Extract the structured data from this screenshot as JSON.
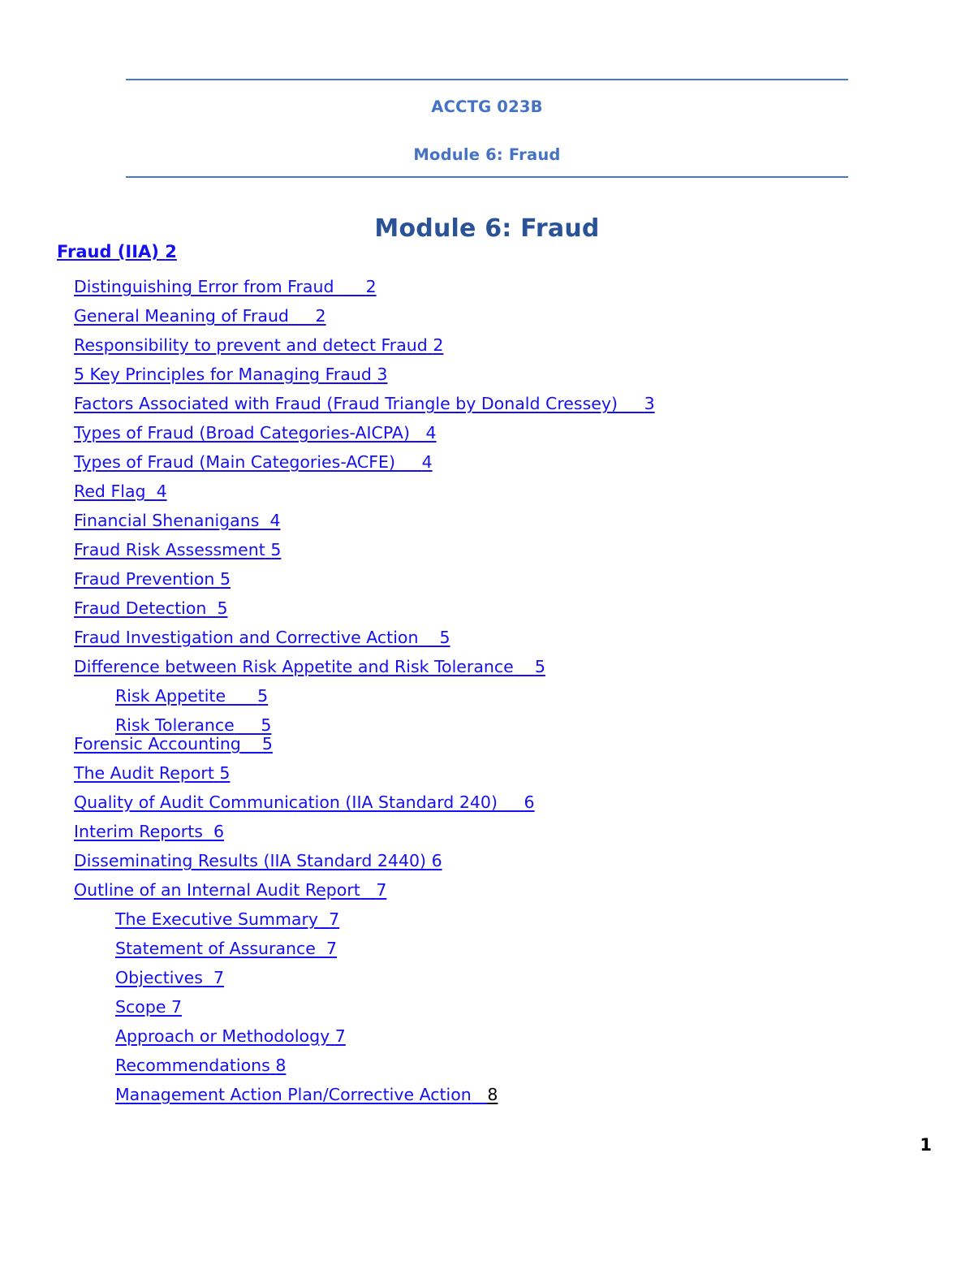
{
  "header": {
    "line1": "ACCTG 023B",
    "line2": "Module 6: Fraud",
    "rule_color": "#4878C8",
    "text_color": "#4472C4"
  },
  "title": {
    "text": "Module 6: Fraud",
    "color": "#2A5296"
  },
  "toc": {
    "link_color": "#1410F0",
    "entries": [
      {
        "label": "Fraud (IIA)",
        "gap": " ",
        "page": "2",
        "level": 0,
        "bold": true,
        "tight": false,
        "page_black": false
      },
      {
        "label": "Distinguishing Error from Fraud",
        "gap": "      ",
        "page": "2",
        "level": 1,
        "bold": false,
        "tight": false,
        "page_black": false
      },
      {
        "label": "General Meaning of Fraud",
        "gap": "     ",
        "page": "2",
        "level": 1,
        "bold": false,
        "tight": false,
        "page_black": false
      },
      {
        "label": "Responsibility to prevent and detect Fraud",
        "gap": " ",
        "page": "2",
        "level": 1,
        "bold": false,
        "tight": false,
        "page_black": false
      },
      {
        "label": "5 Key Principles for Managing Fraud",
        "gap": " ",
        "page": "3",
        "level": 1,
        "bold": false,
        "tight": false,
        "page_black": false
      },
      {
        "label": "Factors Associated with Fraud (Fraud Triangle by Donald Cressey)",
        "gap": "     ",
        "page": "3",
        "level": 1,
        "bold": false,
        "tight": false,
        "page_black": false
      },
      {
        "label": "Types of Fraud (Broad Categories-AICPA)",
        "gap": "   ",
        "page": "4",
        "level": 1,
        "bold": false,
        "tight": false,
        "page_black": false
      },
      {
        "label": "Types of Fraud (Main Categories-ACFE)",
        "gap": "     ",
        "page": "4",
        "level": 1,
        "bold": false,
        "tight": false,
        "page_black": false
      },
      {
        "label": "Red Flag",
        "gap": "  ",
        "page": "4",
        "level": 1,
        "bold": false,
        "tight": false,
        "page_black": false
      },
      {
        "label": "Financial Shenanigans",
        "gap": "  ",
        "page": "4",
        "level": 1,
        "bold": false,
        "tight": false,
        "page_black": false
      },
      {
        "label": "Fraud Risk Assessment",
        "gap": " ",
        "page": "5",
        "level": 1,
        "bold": false,
        "tight": false,
        "page_black": false
      },
      {
        "label": "Fraud Prevention",
        "gap": " ",
        "page": "5",
        "level": 1,
        "bold": false,
        "tight": false,
        "page_black": false
      },
      {
        "label": "Fraud Detection",
        "gap": "  ",
        "page": "5",
        "level": 1,
        "bold": false,
        "tight": false,
        "page_black": false
      },
      {
        "label": "Fraud Investigation and Corrective Action",
        "gap": "    ",
        "page": "5",
        "level": 1,
        "bold": false,
        "tight": false,
        "page_black": false
      },
      {
        "label": "Difference between Risk Appetite and Risk Tolerance",
        "gap": "    ",
        "page": "5",
        "level": 1,
        "bold": false,
        "tight": false,
        "page_black": false
      },
      {
        "label": "Risk Appetite",
        "gap": "      ",
        "page": "5",
        "level": 2,
        "bold": false,
        "tight": false,
        "page_black": false
      },
      {
        "label": "Risk Tolerance",
        "gap": "     ",
        "page": "5",
        "level": 2,
        "bold": false,
        "tight": false,
        "page_black": false
      },
      {
        "label": "Forensic Accounting",
        "gap": "    ",
        "page": "5",
        "level": 1,
        "bold": false,
        "tight": true,
        "page_black": false
      },
      {
        "label": "The Audit Report",
        "gap": " ",
        "page": "5",
        "level": 1,
        "bold": false,
        "tight": false,
        "page_black": false
      },
      {
        "label": "Quality of Audit Communication (IIA Standard 240)",
        "gap": "     ",
        "page": "6",
        "level": 1,
        "bold": false,
        "tight": false,
        "page_black": false
      },
      {
        "label": "Interim Reports",
        "gap": "  ",
        "page": "6",
        "level": 1,
        "bold": false,
        "tight": false,
        "page_black": false
      },
      {
        "label": "Disseminating Results (IIA Standard 2440)",
        "gap": " ",
        "page": "6",
        "level": 1,
        "bold": false,
        "tight": false,
        "page_black": false
      },
      {
        "label": "Outline of an Internal Audit Report",
        "gap": "   ",
        "page": "7",
        "level": 1,
        "bold": false,
        "tight": false,
        "page_black": false
      },
      {
        "label": "The Executive Summary",
        "gap": "  ",
        "page": "7",
        "level": 2,
        "bold": false,
        "tight": false,
        "page_black": false
      },
      {
        "label": "Statement of Assurance",
        "gap": "  ",
        "page": "7",
        "level": 2,
        "bold": false,
        "tight": false,
        "page_black": false
      },
      {
        "label": "Objectives",
        "gap": "  ",
        "page": "7",
        "level": 2,
        "bold": false,
        "tight": false,
        "page_black": false
      },
      {
        "label": "Scope",
        "gap": " ",
        "page": "7",
        "level": 2,
        "bold": false,
        "tight": false,
        "page_black": false
      },
      {
        "label": "Approach or Methodology",
        "gap": " ",
        "page": "7",
        "level": 2,
        "bold": false,
        "tight": false,
        "page_black": false
      },
      {
        "label": "Recommendations",
        "gap": " ",
        "page": "8",
        "level": 2,
        "bold": false,
        "tight": false,
        "page_black": false
      },
      {
        "label": "Management Action Plan/Corrective Action",
        "gap": "   ",
        "page": "8",
        "level": 2,
        "bold": false,
        "tight": false,
        "page_black": true
      }
    ]
  },
  "footer": {
    "page_number": "1"
  }
}
